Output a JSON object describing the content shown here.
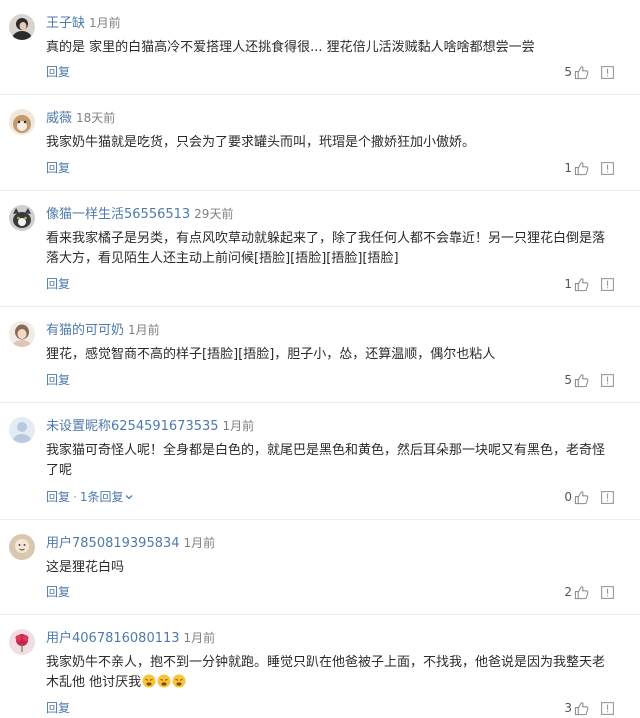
{
  "comments": [
    {
      "author": "王子缺",
      "time": "1月前",
      "text": "真的是 家里的白猫高冷不爱搭理人还挑食得很... 狸花倍儿活泼贼黏人啥啥都想尝一尝",
      "reply_label": "回复",
      "replies_label": "",
      "likes": "5"
    },
    {
      "author": "威薇",
      "time": "18天前",
      "text": "我家奶牛猫就是吃货，只会为了要求罐头而叫，玳瑁是个撒娇狂加小傲娇。",
      "reply_label": "回复",
      "replies_label": "",
      "likes": "1"
    },
    {
      "author": "像猫一样生活56556513",
      "time": "29天前",
      "text": "看来我家橘子是另类，有点风吹草动就躲起来了，除了我任何人都不会靠近！另一只狸花白倒是落落大方，看见陌生人还主动上前问候[捂脸][捂脸][捂脸][捂脸]",
      "reply_label": "回复",
      "replies_label": "",
      "likes": "1"
    },
    {
      "author": "有猫的可可奶",
      "time": "1月前",
      "text": "狸花，感觉智商不高的样子[捂脸][捂脸]，胆子小，怂，还算温顺，偶尔也粘人",
      "reply_label": "回复",
      "replies_label": "",
      "likes": "5"
    },
    {
      "author": "未设置昵称6254591673535",
      "time": "1月前",
      "text": "我家猫可奇怪人呢！全身都是白色的，就尾巴是黑色和黄色，然后耳朵那一块呢又有黑色，老奇怪了呢",
      "reply_label": "回复",
      "replies_label": "1条回复",
      "likes": "0"
    },
    {
      "author": "用户7850819395834",
      "time": "1月前",
      "text": "这是狸花白吗",
      "reply_label": "回复",
      "replies_label": "",
      "likes": "2"
    },
    {
      "author": "用户4067816080113",
      "time": "1月前",
      "text": "我家奶牛不亲人，抱不到一分钟就跑。睡觉只趴在他爸被子上面，不找我，他爸说是因为我整天老木乱他 他讨厌我",
      "reply_label": "回复",
      "replies_label": "",
      "likes": "3"
    }
  ]
}
